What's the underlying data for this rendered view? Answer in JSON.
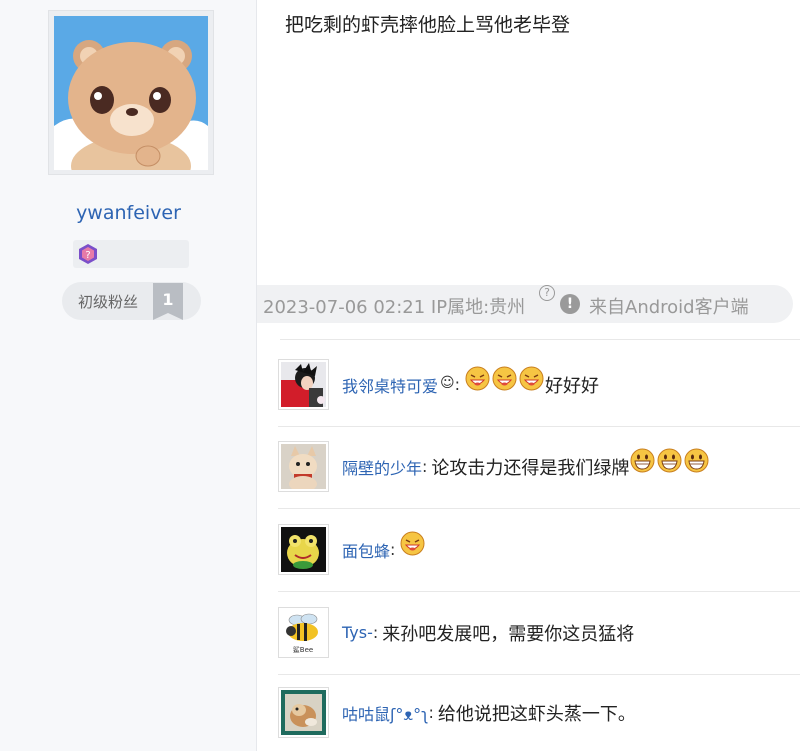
{
  "author": {
    "username": "ywanfeiver",
    "level_title": "初级粉丝",
    "level_number": "1"
  },
  "post": {
    "content": "把吃剩的虾壳摔他脸上骂他老毕登",
    "date": "2023-07-06 02:21 IP属地:贵州",
    "help_icon": "?",
    "warn_icon": "!",
    "source": "来自Android客户端"
  },
  "comments": [
    {
      "name": "我邻桌特可爱",
      "name_emoji": "☺",
      "colon": ":",
      "emojis": [
        "laugh",
        "laugh",
        "laugh"
      ],
      "text": "好好好"
    },
    {
      "name": "隔壁的少年",
      "colon": ":",
      "text": "论攻击力还得是我们绿牌",
      "emojis_after": [
        "grin",
        "grin",
        "grin"
      ]
    },
    {
      "name": "面包蜂",
      "colon": ":",
      "emojis": [
        "laugh"
      ],
      "text": ""
    },
    {
      "name": "Tys-",
      "colon": ":",
      "text": "来孙吧发展吧，需要你这员猛将"
    },
    {
      "name": "咕咕鼠ʃ°ᴥ°ʅ",
      "colon": ":",
      "text": "给他说把这虾头蒸一下。"
    }
  ],
  "avatar_badges": {
    "tys_caption": "鲨Bee"
  },
  "colors": {
    "link": "#2d64b3",
    "meta": "#999999",
    "panel": "#f7f8fa"
  }
}
